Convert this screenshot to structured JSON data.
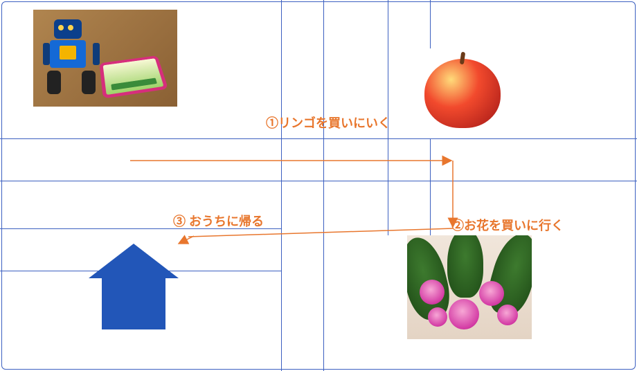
{
  "diagram": {
    "description": "Map-style route diagram on a street grid showing a robot's shopping errands and return home",
    "start_image": "robot-with-tablet",
    "destinations": [
      "apple",
      "flowers",
      "house"
    ]
  },
  "steps": [
    {
      "order": 1,
      "text": "①リンゴを買いにいく",
      "target": "apple"
    },
    {
      "order": 2,
      "text": "②お花を買いに行く",
      "target": "flowers"
    },
    {
      "order": 3,
      "text": "③ おうちに帰る",
      "target": "house"
    }
  ],
  "colors": {
    "road": "#3b5fc0",
    "arrow": "#e8762d",
    "house": "#2256b8"
  }
}
